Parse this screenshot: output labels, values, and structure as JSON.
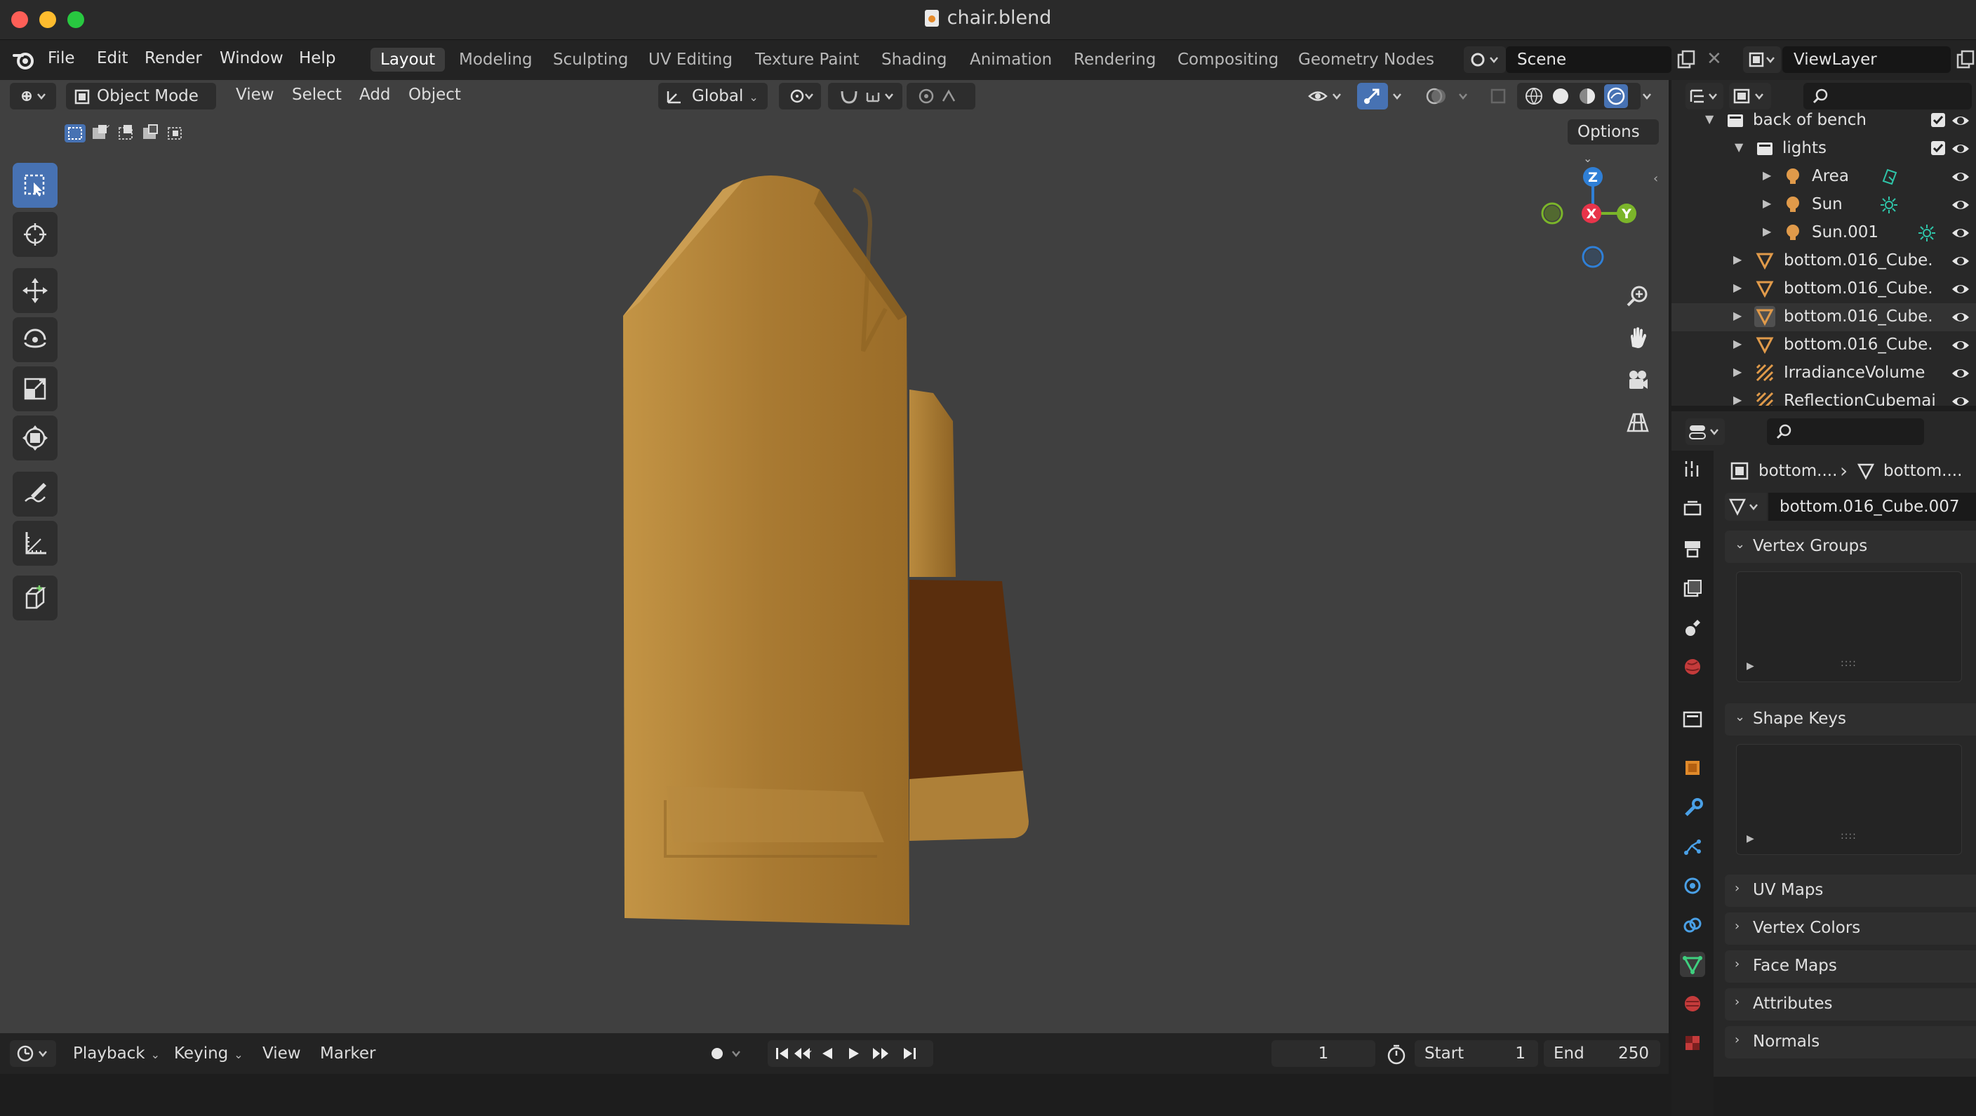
{
  "window": {
    "title": "chair.blend"
  },
  "menubar": {
    "menus": [
      "File",
      "Edit",
      "Render",
      "Window",
      "Help"
    ],
    "workspaces": [
      "Layout",
      "Modeling",
      "Sculpting",
      "UV Editing",
      "Texture Paint",
      "Shading",
      "Animation",
      "Rendering",
      "Compositing",
      "Geometry Nodes"
    ],
    "active_workspace": "Layout",
    "scene": "Scene",
    "view_layer": "ViewLayer"
  },
  "viewport": {
    "mode": "Object Mode",
    "menus": [
      "View",
      "Select",
      "Add",
      "Object"
    ],
    "transform_orientation": "Global",
    "options_label": "Options",
    "gizmo": {
      "z": "Z",
      "x": "X",
      "y": "Y"
    }
  },
  "timeline": {
    "menus": [
      "Playback",
      "Keying",
      "View",
      "Marker"
    ],
    "current_frame": "1",
    "start_label": "Start",
    "start_value": "1",
    "end_label": "End",
    "end_value": "250"
  },
  "outliner": {
    "rows": [
      {
        "label": "back of bench",
        "icon": "collection-icon"
      },
      {
        "label": "lights",
        "icon": "collection-icon"
      },
      {
        "label": "Area",
        "icon": "light-icon"
      },
      {
        "label": "Sun",
        "icon": "light-icon"
      },
      {
        "label": "Sun.001",
        "icon": "light-icon"
      },
      {
        "label": "bottom.016_Cube.",
        "icon": "mesh-icon"
      },
      {
        "label": "bottom.016_Cube.",
        "icon": "mesh-icon"
      },
      {
        "label": "bottom.016_Cube.",
        "icon": "mesh-icon"
      },
      {
        "label": "bottom.016_Cube.",
        "icon": "mesh-icon"
      },
      {
        "label": "IrradianceVolume",
        "icon": "lightprobe-icon"
      },
      {
        "label": "ReflectionCubemai",
        "icon": "lightprobe-icon"
      }
    ]
  },
  "properties": {
    "breadcrumb_object": "bottom....",
    "breadcrumb_data": "bottom....",
    "mesh_name": "bottom.016_Cube.007",
    "panels": [
      "Vertex Groups",
      "Shape Keys",
      "UV Maps",
      "Vertex Colors",
      "Face Maps",
      "Attributes",
      "Normals"
    ]
  },
  "colors": {
    "accent": "#4772b3",
    "axis_x": "#e8344a",
    "axis_y": "#7bb52a",
    "axis_z": "#2f7fd6",
    "wood": "#a97a32"
  }
}
